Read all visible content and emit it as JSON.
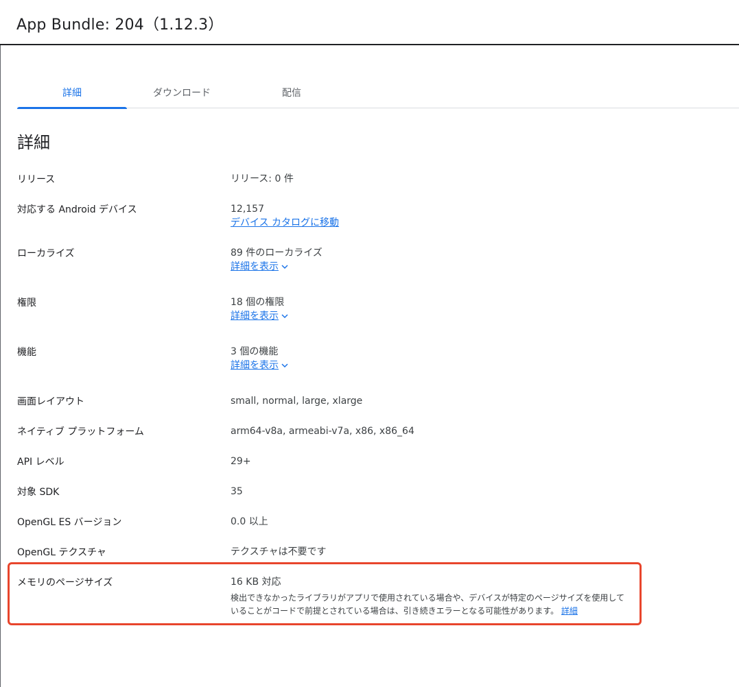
{
  "header": {
    "title": "App Bundle: 204（1.12.3）"
  },
  "tabs": [
    {
      "label": "詳細",
      "active": true
    },
    {
      "label": "ダウンロード",
      "active": false
    },
    {
      "label": "配信",
      "active": false
    }
  ],
  "section_title": "詳細",
  "rows": {
    "release": {
      "label": "リリース",
      "value": "リリース: 0 件"
    },
    "devices": {
      "label": "対応する Android デバイス",
      "value": "12,157",
      "link": "デバイス カタログに移動"
    },
    "localize": {
      "label": "ローカライズ",
      "value": "89 件のローカライズ",
      "link": "詳細を表示"
    },
    "permissions": {
      "label": "権限",
      "value": "18 個の権限",
      "link": "詳細を表示"
    },
    "features": {
      "label": "機能",
      "value": "3 個の機能",
      "link": "詳細を表示"
    },
    "screen_layout": {
      "label": "画面レイアウト",
      "value": "small, normal, large, xlarge"
    },
    "native_platform": {
      "label": "ネイティブ プラットフォーム",
      "value": "arm64-v8a, armeabi-v7a, x86, x86_64"
    },
    "api_level": {
      "label": "API レベル",
      "value": "29+"
    },
    "target_sdk": {
      "label": "対象 SDK",
      "value": "35"
    },
    "opengl_version": {
      "label": "OpenGL ES バージョン",
      "value": "0.0 以上"
    },
    "opengl_texture": {
      "label": "OpenGL テクスチャ",
      "value": "テクスチャは不要です"
    },
    "memory_page": {
      "label": "メモリのページサイズ",
      "value": "16 KB 対応",
      "note": "検出できなかったライブラリがアプリで使用されている場合や、デバイスが特定のページサイズを使用していることがコードで前提とされている場合は、引き続きエラーとなる可能性があります。",
      "note_link": "詳細"
    }
  },
  "colors": {
    "accent": "#1a73e8",
    "highlight": "#e8452c"
  },
  "icons": {
    "expand": "chevron-down-icon"
  }
}
